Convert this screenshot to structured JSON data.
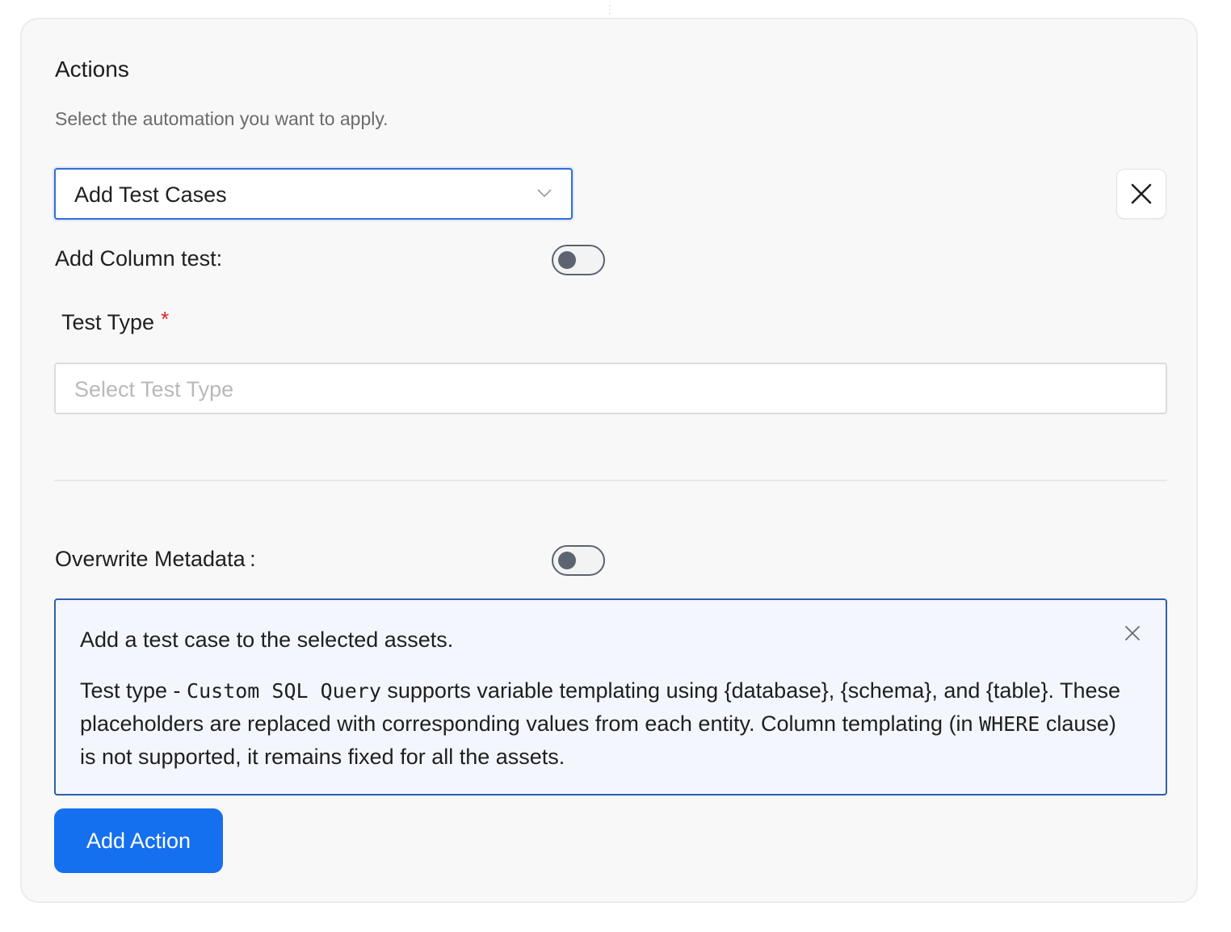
{
  "section": {
    "title": "Actions",
    "subtitle": "Select the automation you want to apply."
  },
  "action_select": {
    "selected_value": "Add Test Cases"
  },
  "add_column_test": {
    "label": "Add Column test:",
    "enabled": false
  },
  "test_type": {
    "label": "Test Type",
    "required_marker": "*",
    "placeholder": "Select Test Type"
  },
  "overwrite_metadata": {
    "label": "Overwrite Metadata",
    "colon": ":",
    "enabled": false
  },
  "info_message": {
    "title": "Add a test case to the selected assets.",
    "body_prefix": "Test type - ",
    "body_code": "Custom SQL Query",
    "body_mid": " supports variable templating using {database}, {schema}, and {table}. These placeholders are replaced with corresponding values from each entity. Column templating (in ",
    "body_code_2": "WHERE",
    "body_suffix": " clause) is not supported, it remains fixed for all the assets."
  },
  "buttons": {
    "add_action_label": "Add Action"
  },
  "colors": {
    "primary": "#1570ef",
    "focus_border": "#2f6fdb",
    "info_border": "#2f5fae",
    "required": "#d9262a",
    "toggle_off": "#5b6470"
  },
  "icons": {
    "select_caret": "chevron-down-icon",
    "remove_action": "close-icon",
    "dismiss_info": "close-icon",
    "drag": "drag-handle-icon"
  }
}
